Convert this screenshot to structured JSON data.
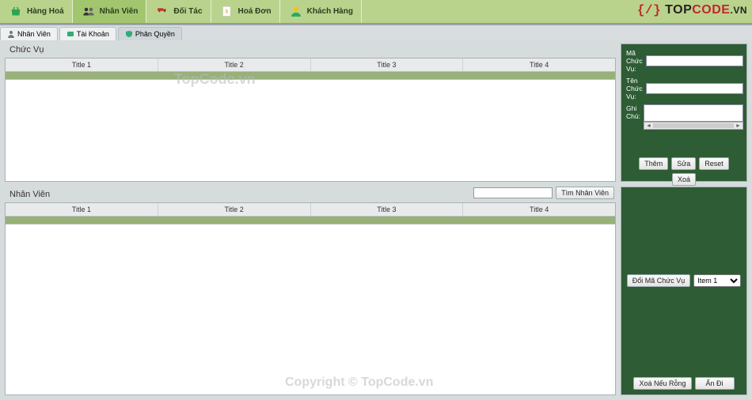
{
  "logo": {
    "top": "TOP",
    "code": "CODE",
    "vn": ".VN"
  },
  "ribbon": [
    {
      "label": "Hàng Hoá",
      "iconColor": "#2fa44f"
    },
    {
      "label": "Nhân Viên",
      "iconColor": "#333",
      "active": true
    },
    {
      "label": "Đối Tác",
      "iconColor": "#c0392b"
    },
    {
      "label": "Hoá Đơn",
      "iconColor": "#f39c12"
    },
    {
      "label": "Khách Hàng",
      "iconColor": "#f1c40f"
    }
  ],
  "subtabs": [
    {
      "label": "Nhân Viên"
    },
    {
      "label": "Tài Khoản"
    },
    {
      "label": "Phân Quyền",
      "active": true
    }
  ],
  "sectionTop": {
    "title": "Chức Vụ",
    "columns": [
      "Title 1",
      "Title 2",
      "Title 3",
      "Title 4"
    ]
  },
  "sectionBottom": {
    "title": "Nhân Viên",
    "searchPlaceholder": "",
    "searchButton": "Tìm Nhân Viên",
    "columns": [
      "Title 1",
      "Title 2",
      "Title 3",
      "Title 4"
    ]
  },
  "formTop": {
    "field1": "Mã Chức Vụ:",
    "field2": "Tên Chức Vụ:",
    "field3": "Ghi Chú:",
    "buttons": [
      "Thêm",
      "Sửa",
      "Reset",
      "Xoá"
    ]
  },
  "formBottom": {
    "changeBtn": "Đổi Mã Chức Vụ",
    "selectOptions": [
      "Item 1"
    ],
    "selectedOption": "Item 1",
    "deleteEmpty": "Xoá Nếu Rỗng",
    "hideBtn": "Ẩn Đi"
  },
  "watermarks": {
    "wm1": "TopCode.vn",
    "wm2": "Copyright © TopCode.vn"
  }
}
